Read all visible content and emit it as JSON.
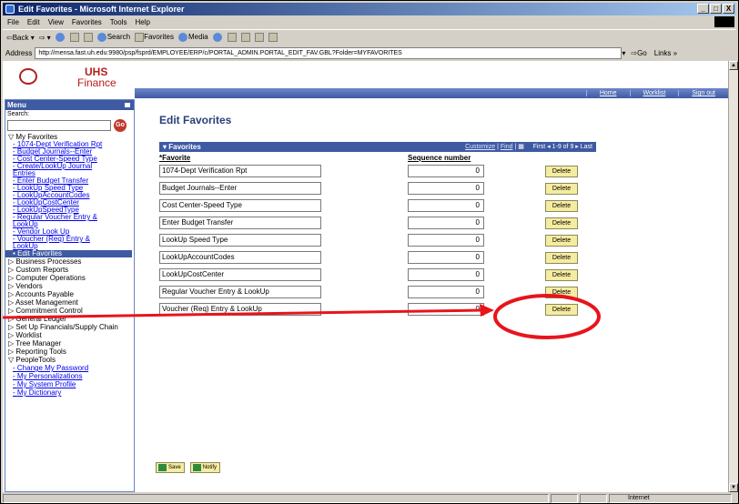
{
  "window": {
    "title": "Edit Favorites - Microsoft Internet Explorer",
    "buttons": [
      "_",
      "□",
      "X"
    ]
  },
  "menubar": [
    "File",
    "Edit",
    "View",
    "Favorites",
    "Tools",
    "Help"
  ],
  "toolbar": {
    "back": "Back",
    "search": "Search",
    "favorites": "Favorites",
    "media": "Media"
  },
  "address": {
    "label": "Address",
    "url": "http://mensa.fast.uh.edu:9980/psp/fsprd/EMPLOYEE/ERP/c/PORTAL_ADMIN.PORTAL_EDIT_FAV.GBL?Folder=MYFAVORITES",
    "go": "Go",
    "links": "Links"
  },
  "logo": {
    "line1": "UHS",
    "line2": "Finance"
  },
  "topnav": [
    "Home",
    "Worklist",
    "Sign out"
  ],
  "menu": {
    "title": "Menu",
    "search_label": "Search:",
    "go": "Go",
    "my_favorites": "My Favorites",
    "favorites": [
      "1074-Dept Verification Rpt",
      "Budget Journals--Enter",
      "Cost Center-Speed Type",
      "Create/LookUp Journal Entries",
      "Enter Budget Transfer",
      "LookUp Speed Type",
      "LookUpAccountCodes",
      "LookUpCostCenter",
      "LookUpSpeedType",
      "Regular Voucher Entry & LookUp",
      "Vendor Look Up",
      "Voucher (Req) Entry & LookUp"
    ],
    "selected": "Edit Favorites",
    "categories": [
      "Business Processes",
      "Custom Reports",
      "Computer Operations",
      "Vendors",
      "Accounts Payable",
      "Asset Management",
      "Commitment Control",
      "General Ledger",
      "Set Up Financials/Supply Chain",
      "Worklist",
      "Tree Manager",
      "Reporting Tools",
      "PeopleTools"
    ],
    "bottom_links": [
      "Change My Password",
      "My Personalizations",
      "My System Profile",
      "My Dictionary"
    ]
  },
  "main": {
    "title": "Edit Favorites",
    "grid": {
      "title": "Favorites",
      "customize": "Customize",
      "find": "Find",
      "nav": "First",
      "range": "1-9 of 9",
      "last": "Last",
      "col_favorite": "*Favorite",
      "col_sequence": "Sequence number",
      "rows": [
        {
          "favorite": "1074-Dept Verification Rpt",
          "seq": "0"
        },
        {
          "favorite": "Budget Journals--Enter",
          "seq": "0"
        },
        {
          "favorite": "Cost Center-Speed Type",
          "seq": "0"
        },
        {
          "favorite": "Enter Budget Transfer",
          "seq": "0"
        },
        {
          "favorite": "LookUp Speed Type",
          "seq": "0"
        },
        {
          "favorite": "LookUpAccountCodes",
          "seq": "0"
        },
        {
          "favorite": "LookUpCostCenter",
          "seq": "0"
        },
        {
          "favorite": "Regular Voucher Entry & LookUp",
          "seq": "0"
        },
        {
          "favorite": "Voucher (Req) Entry & LookUp",
          "seq": "0"
        }
      ],
      "delete_label": "Delete"
    },
    "save": "Save",
    "notify": "Notify"
  },
  "status": {
    "zone": "Internet"
  },
  "annotation": {
    "color": "#e8141c"
  }
}
